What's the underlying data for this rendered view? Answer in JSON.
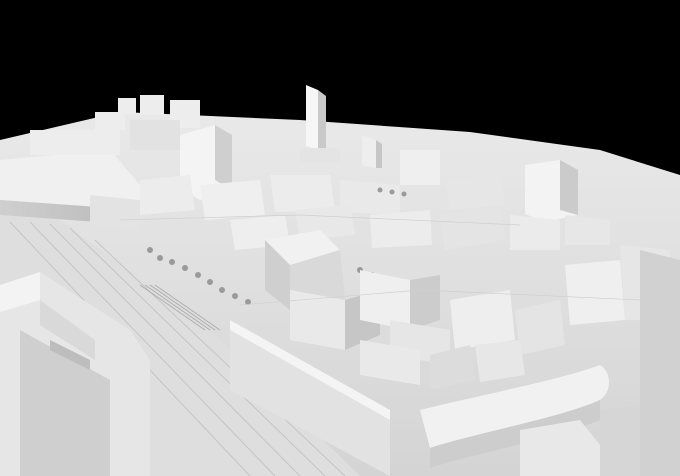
{
  "scene": {
    "subject": "architectural-massing-model",
    "background_color": "#000000",
    "model_color": "#f2f2f2",
    "shadow_color": "#bdbdbd"
  }
}
